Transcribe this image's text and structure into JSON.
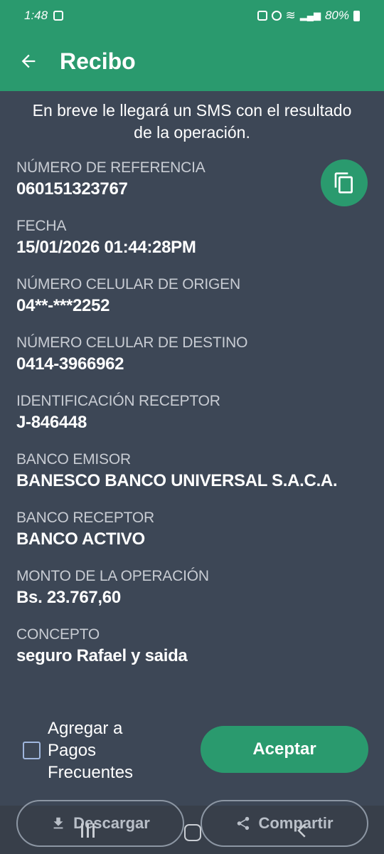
{
  "status_bar": {
    "time": "1:48",
    "battery": "80%"
  },
  "app_bar": {
    "title": "Recibo"
  },
  "notice": "En breve le llegará un SMS con el resultado de la operación.",
  "fields": [
    {
      "label": "NÚMERO DE REFERENCIA",
      "value": "060151323767"
    },
    {
      "label": "FECHA",
      "value": "15/01/2026 01:44:28PM"
    },
    {
      "label": "NÚMERO CELULAR DE ORIGEN",
      "value": "04**-***2252"
    },
    {
      "label": "NÚMERO CELULAR DE DESTINO",
      "value": "0414-3966962"
    },
    {
      "label": "IDENTIFICACIÓN RECEPTOR",
      "value": "J-846448"
    },
    {
      "label": "BANCO EMISOR",
      "value": "BANESCO BANCO UNIVERSAL S.A.C.A."
    },
    {
      "label": "BANCO RECEPTOR",
      "value": "BANCO ACTIVO"
    },
    {
      "label": "MONTO DE LA OPERACIÓN",
      "value": "Bs. 23.767,60"
    },
    {
      "label": "CONCEPTO",
      "value": "seguro Rafael y saida"
    }
  ],
  "actions": {
    "checkbox_label": "Agregar a Pagos Frecuentes",
    "accept_label": "Aceptar",
    "download_label": "Descargar",
    "share_label": "Compartir"
  },
  "icons": {
    "back": "arrow-left-icon",
    "copy": "copy-icon",
    "download": "download-icon",
    "share": "share-icon"
  },
  "colors": {
    "brand": "#2a9a6e",
    "background": "#3d4756"
  }
}
